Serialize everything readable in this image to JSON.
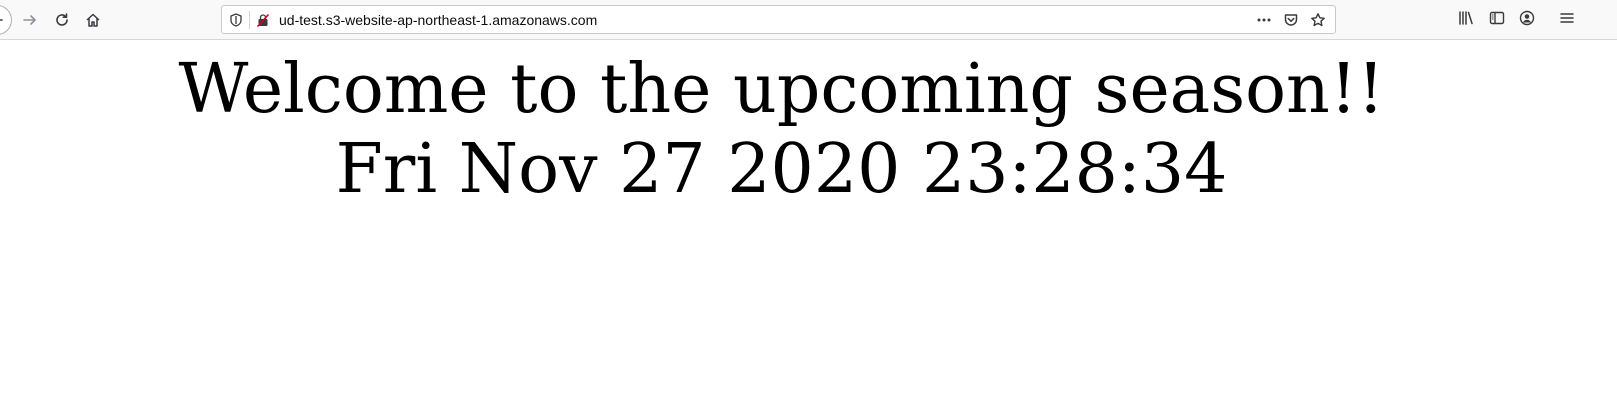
{
  "browser": {
    "url": "ud-test.s3-website-ap-northeast-1.amazonaws.com",
    "nav_icons": [
      "back-icon",
      "forward-icon",
      "reload-icon",
      "home-icon"
    ],
    "urlbar_icons": [
      "tracking-protection-shield-icon",
      "insecure-connection-icon",
      "page-actions-icon",
      "pocket-icon",
      "bookmark-star-icon"
    ],
    "toolbar_icons": [
      "library-icon",
      "sidebar-icon",
      "account-icon",
      "hamburger-menu-icon"
    ],
    "colors": {
      "toolbar_bg": "#f9f9fa",
      "insecure_icon": "#d70022"
    }
  },
  "page": {
    "headline": "Welcome to the upcoming season!!",
    "datetime": "Fri Nov 27 2020 23:28:34"
  }
}
